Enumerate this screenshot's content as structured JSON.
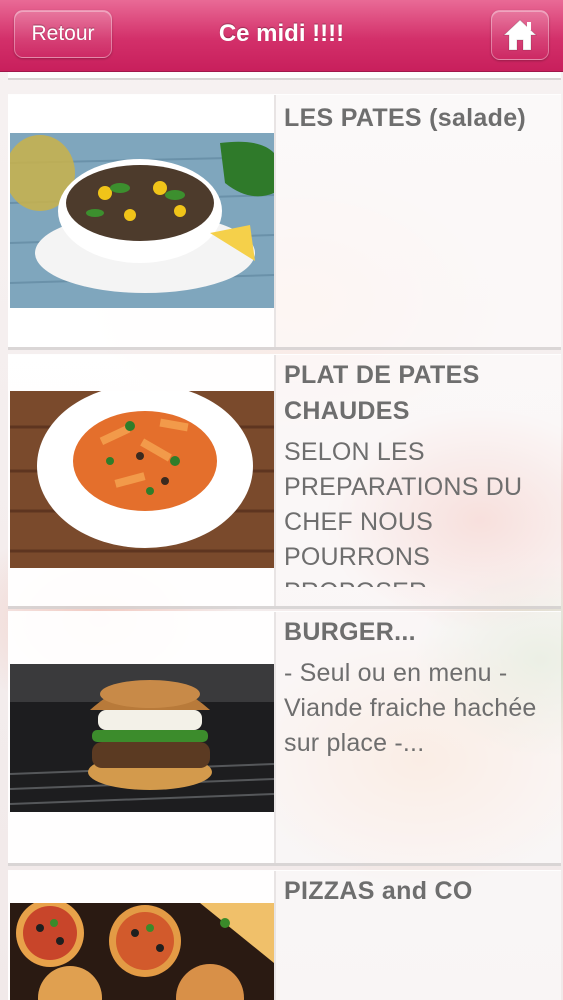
{
  "header": {
    "back_label": "Retour",
    "title": "Ce midi !!!!",
    "home_icon": "home-icon"
  },
  "items": [
    {
      "title": "LES PATES (salade)",
      "description": "",
      "image": "pasta-salad-photo"
    },
    {
      "title": "PLAT DE PATES CHAUDES",
      "description": "SELON LES PREPARATIONS DU CHEF NOUS POURRONS PROPOSER...",
      "image": "penne-plate-photo"
    },
    {
      "title": "BURGER...",
      "description": "- Seul ou en menu - Viande fraiche hachée sur place -...",
      "image": "burger-photo"
    },
    {
      "title": "PIZZAS and CO",
      "description": "",
      "image": "pizzas-photo"
    }
  ],
  "colors": {
    "header_top": "#e96a96",
    "header_bottom": "#c81f5c",
    "text": "#6e6e6e"
  }
}
